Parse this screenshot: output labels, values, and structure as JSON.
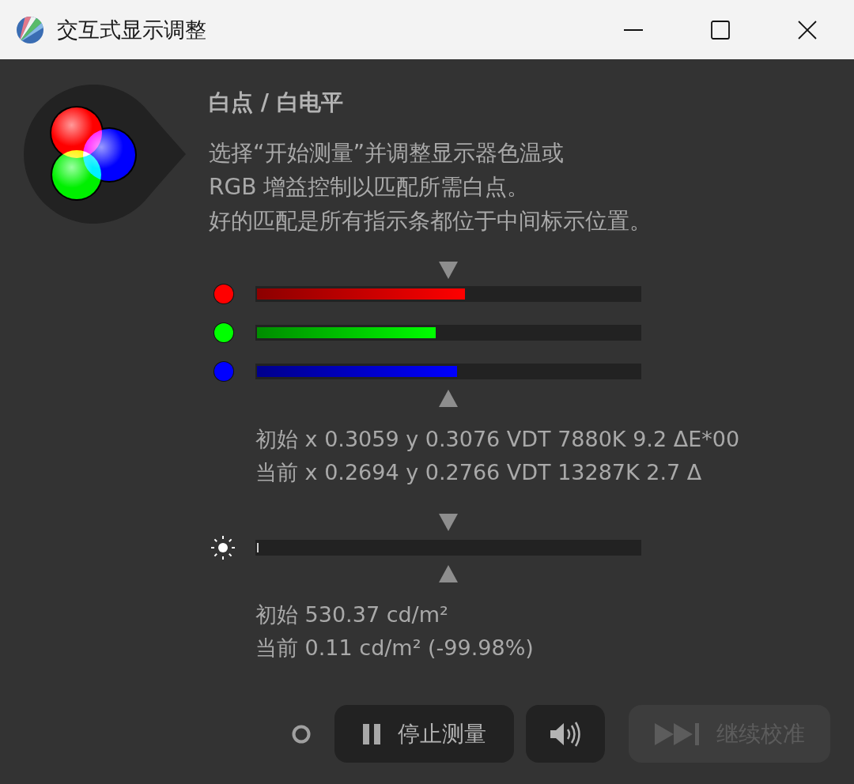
{
  "window": {
    "title": "交互式显示调整"
  },
  "header": {
    "heading": "白点 / 白电平",
    "instructions": [
      "选择“开始测量”并调整显示器色温或",
      "RGB 增益控制以匹配所需白点。",
      "好的匹配是所有指示条都位于中间标示位置。"
    ]
  },
  "rgb_channels": [
    {
      "color": "#ff0000",
      "level": 0.543
    },
    {
      "color": "#00ff00",
      "level": 0.467
    },
    {
      "color": "#0000ff",
      "level": 0.523
    }
  ],
  "chromaticity": {
    "initial": "初始 x 0.3059 y 0.3076 VDT 7880K 9.2 ΔE*00",
    "current": "当前 x 0.2694 y 0.2766 VDT 13287K 2.7 Δ"
  },
  "luminance": {
    "level": 0.004,
    "initial": "初始 530.37 cd/m²",
    "current": "当前 0.11 cd/m² (-99.98%)"
  },
  "buttons": [
    {
      "kind": "pause",
      "label": "停止测量",
      "disabled": false
    },
    {
      "kind": "sound",
      "disabled": false
    },
    {
      "kind": "skip",
      "label": "继续校准",
      "disabled": true
    }
  ]
}
